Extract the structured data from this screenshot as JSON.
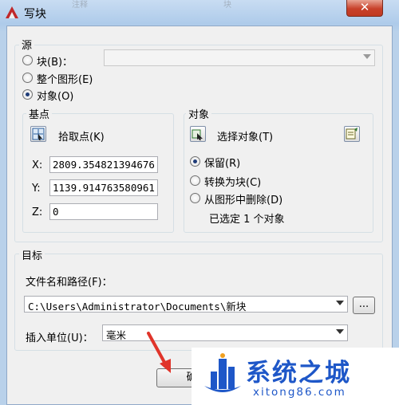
{
  "window": {
    "title": "写块",
    "close_glyph": "✕",
    "faint_tabs": [
      "注释",
      "块"
    ]
  },
  "source": {
    "group_label": "源",
    "block_label": "块(B)：",
    "whole_drawing_label": "整个图形(E)",
    "objects_label": "对象(O)",
    "selected": "objects"
  },
  "base_point": {
    "group_label": "基点",
    "pick_label": "拾取点(K)",
    "x_label": "X:",
    "x_value": "2809.354821394676",
    "y_label": "Y:",
    "y_value": "1139.914763580961",
    "z_label": "Z:",
    "z_value": "0"
  },
  "objects": {
    "group_label": "对象",
    "select_label": "选择对象(T)",
    "retain_label": "保留(R)",
    "convert_label": "转换为块(C)",
    "delete_label": "从图形中删除(D)",
    "selected_retention": "retain",
    "status": "已选定 1 个对象"
  },
  "destination": {
    "group_label": "目标",
    "path_label": "文件名和路径(F)：",
    "path_value": "C:\\Users\\Administrator\\Documents\\新块",
    "browse_label": "...",
    "units_label": "插入单位(U)：",
    "units_value": "毫米"
  },
  "buttons": {
    "ok_label": "确"
  },
  "watermark": {
    "brand": "系统之城",
    "url": "xitong86.com"
  },
  "colors": {
    "accent_arrow": "#e0342a",
    "watermark": "#1e57c8",
    "close": "#c8412a"
  }
}
